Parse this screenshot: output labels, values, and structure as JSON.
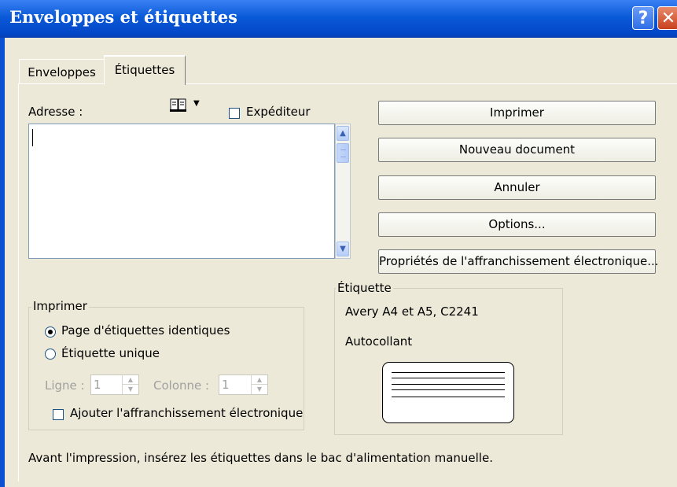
{
  "window": {
    "title": "Enveloppes et étiquettes",
    "help_glyph": "?",
    "close_glyph": "✕"
  },
  "tabs": [
    {
      "label": "Enveloppes",
      "selected": false
    },
    {
      "label": "Étiquettes",
      "selected": true
    }
  ],
  "address": {
    "label": "Adresse :",
    "value": "",
    "address_book_icon": "address-book-icon",
    "dropdown_glyph": "▼"
  },
  "sender": {
    "label": "Expéditeur",
    "checked": false
  },
  "buttons": {
    "print": "Imprimer",
    "new_document": "Nouveau document",
    "cancel": "Annuler",
    "options": "Options...",
    "postage_properties": "Propriétés de l'affranchissement électronique..."
  },
  "print_group": {
    "title": "Imprimer",
    "full_page": "Page d'étiquettes identiques",
    "single_label": "Étiquette unique",
    "selected": "full_page",
    "row_label": "Ligne :",
    "row_value": "1",
    "column_label": "Colonne :",
    "column_value": "1",
    "add_postage": "Ajouter l'affranchissement électronique",
    "add_postage_checked": false
  },
  "label_group": {
    "title": "Étiquette",
    "product": "Avery A4 et A5, C2241",
    "type": "Autocollant"
  },
  "footer": {
    "hint": "Avant l'impression, insérez les étiquettes dans le bac d'alimentation manuelle."
  },
  "colors": {
    "titlebar": "#0a5ad8",
    "dialog": "#ece9d8",
    "close": "#c8401e"
  }
}
